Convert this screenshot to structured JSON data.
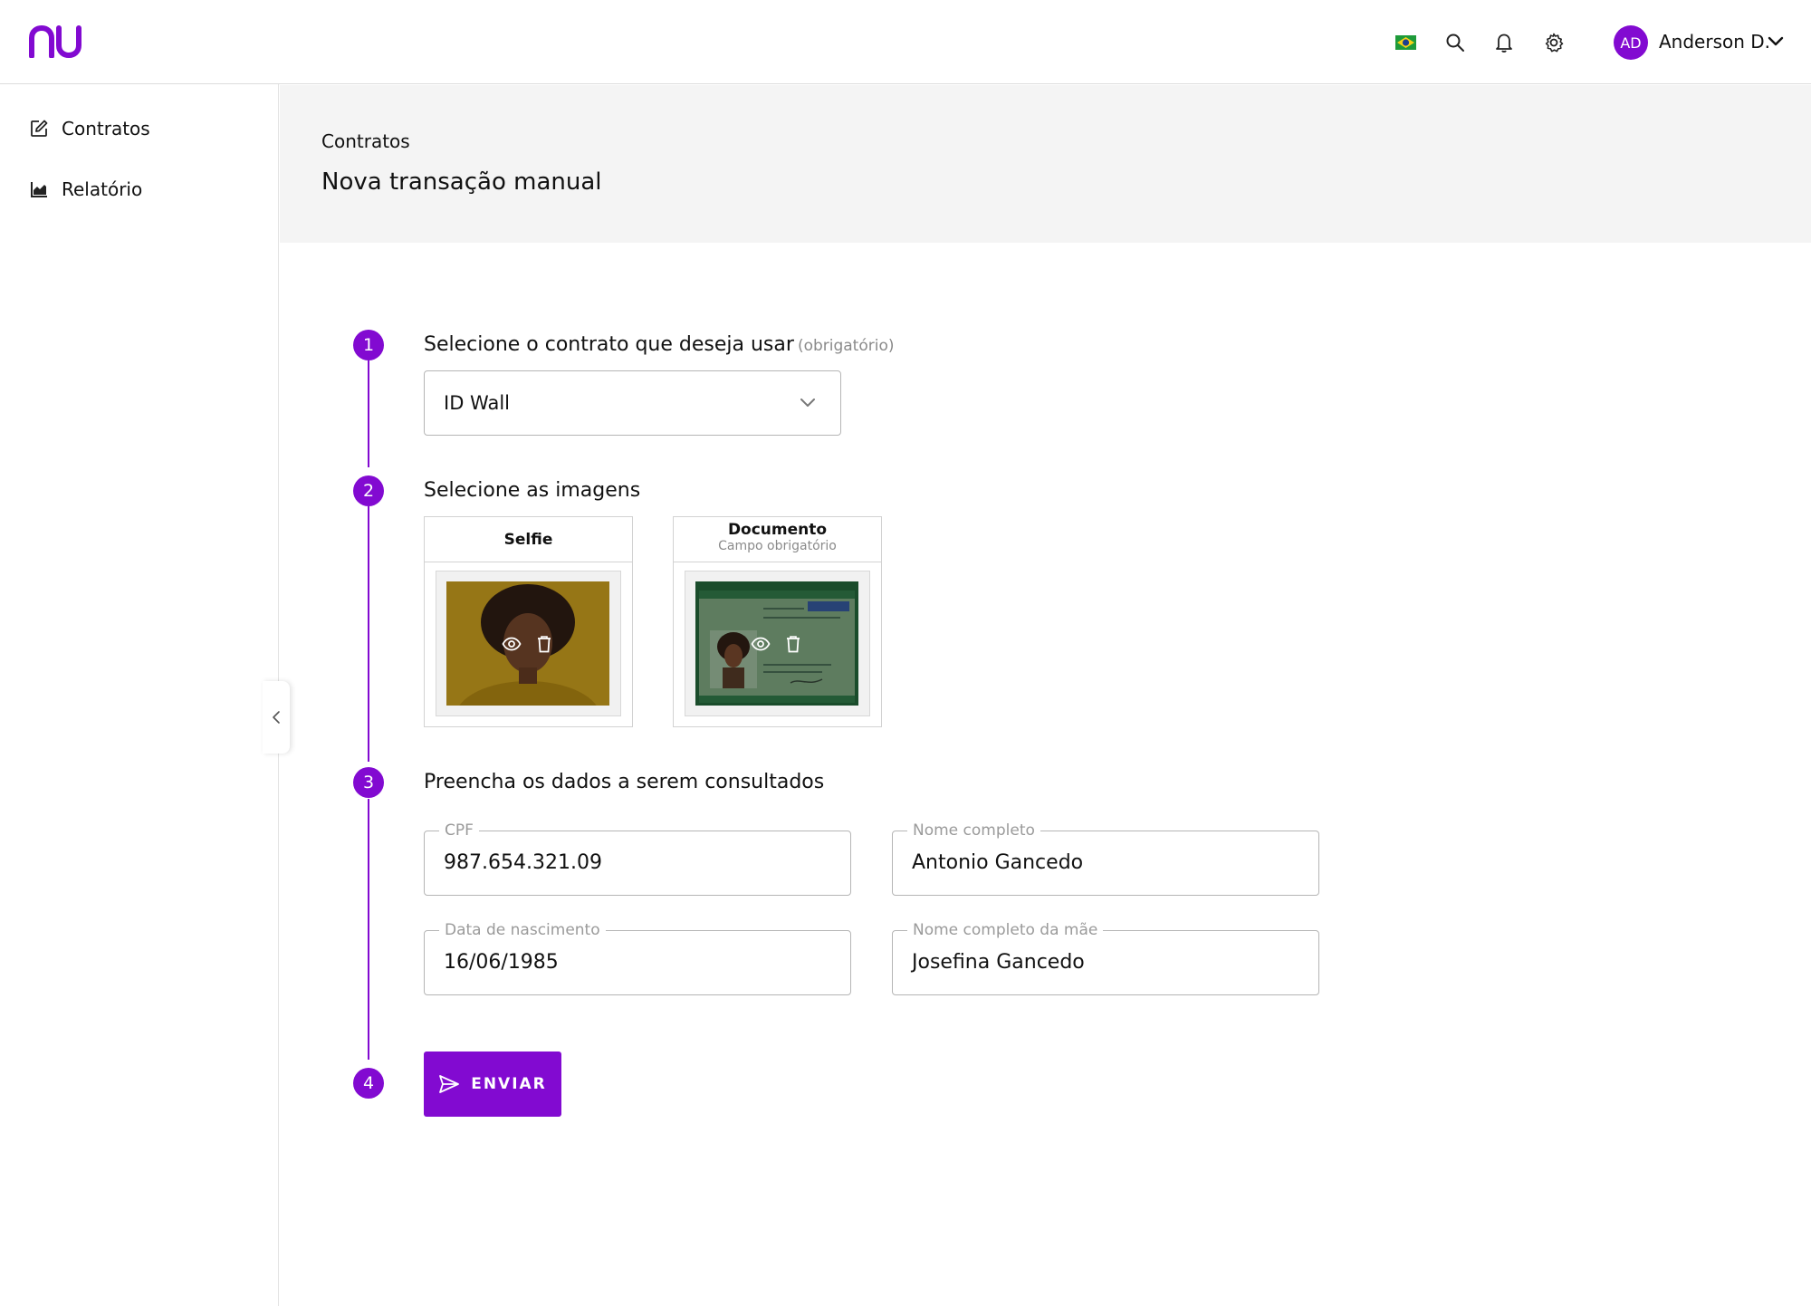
{
  "header": {
    "logo": "nu",
    "icons": [
      "brazil-flag-icon",
      "search-icon",
      "bell-icon",
      "gear-icon"
    ],
    "user": {
      "initials": "AD",
      "name": "Anderson D."
    }
  },
  "sidebar": {
    "items": [
      {
        "label": "Contratos",
        "icon": "edit-icon"
      },
      {
        "label": "Relatório",
        "icon": "chart-icon"
      }
    ]
  },
  "page": {
    "breadcrumb": "Contratos",
    "title": "Nova transação manual"
  },
  "steps": {
    "step1": {
      "number": "1",
      "title": "Selecione o contrato que deseja usar",
      "optional": "(obrigatório)",
      "selected": "ID Wall"
    },
    "step2": {
      "number": "2",
      "title": "Selecione as imagens",
      "cards": [
        {
          "title": "Selfie",
          "subtitle": ""
        },
        {
          "title": "Documento",
          "subtitle": "Campo obrigatório"
        }
      ]
    },
    "step3": {
      "number": "3",
      "title": "Preencha os dados a serem consultados",
      "fields": {
        "cpf": {
          "label": "CPF",
          "value": "987.654.321.09"
        },
        "nome": {
          "label": "Nome completo",
          "value": "Antonio Gancedo"
        },
        "nascimento": {
          "label": "Data de nascimento",
          "value": "16/06/1985"
        },
        "mae": {
          "label": "Nome completo da mãe",
          "value": "Josefina Gancedo"
        }
      }
    },
    "step4": {
      "number": "4",
      "button_label": "ENVIAR"
    }
  },
  "colors": {
    "accent": "#820ad1",
    "page_band": "#f4f4f4",
    "border": "#b5b5b5"
  }
}
